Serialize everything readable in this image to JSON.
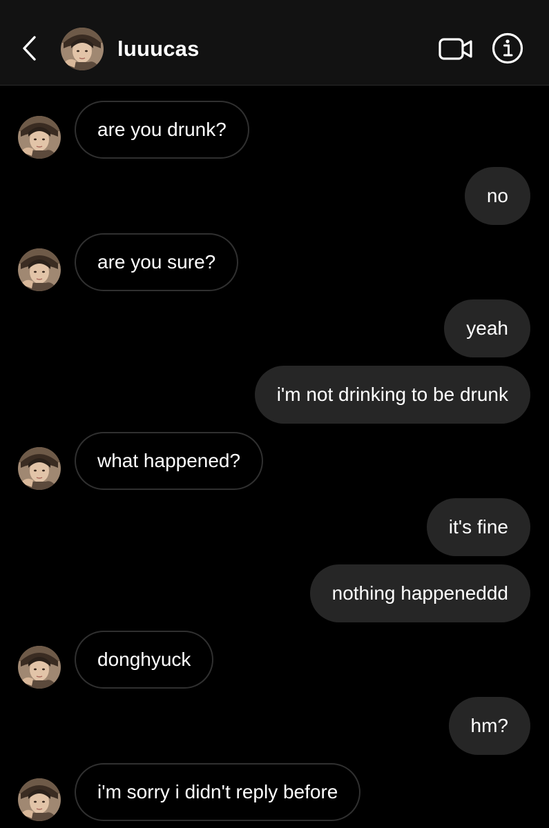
{
  "header": {
    "username": "luuucas",
    "back_icon": "chevron-left-icon",
    "video_icon": "video-camera-icon",
    "info_icon": "info-circle-icon"
  },
  "colors": {
    "background": "#000000",
    "header_background": "#121212",
    "incoming_bubble_border": "#303030",
    "outgoing_bubble_fill": "#262626",
    "text": "#ffffff"
  },
  "messages": [
    {
      "direction": "incoming",
      "text": "are you drunk?"
    },
    {
      "direction": "outgoing",
      "text": "no"
    },
    {
      "direction": "incoming",
      "text": "are you sure?"
    },
    {
      "direction": "outgoing",
      "text": "yeah"
    },
    {
      "direction": "outgoing",
      "text": "i'm not drinking to be drunk"
    },
    {
      "direction": "incoming",
      "text": "what happened?"
    },
    {
      "direction": "outgoing",
      "text": "it's fine"
    },
    {
      "direction": "outgoing",
      "text": "nothing happeneddd"
    },
    {
      "direction": "incoming",
      "text": "donghyuck"
    },
    {
      "direction": "outgoing",
      "text": "hm?"
    },
    {
      "direction": "incoming",
      "text": "i'm sorry i didn't reply before"
    }
  ]
}
